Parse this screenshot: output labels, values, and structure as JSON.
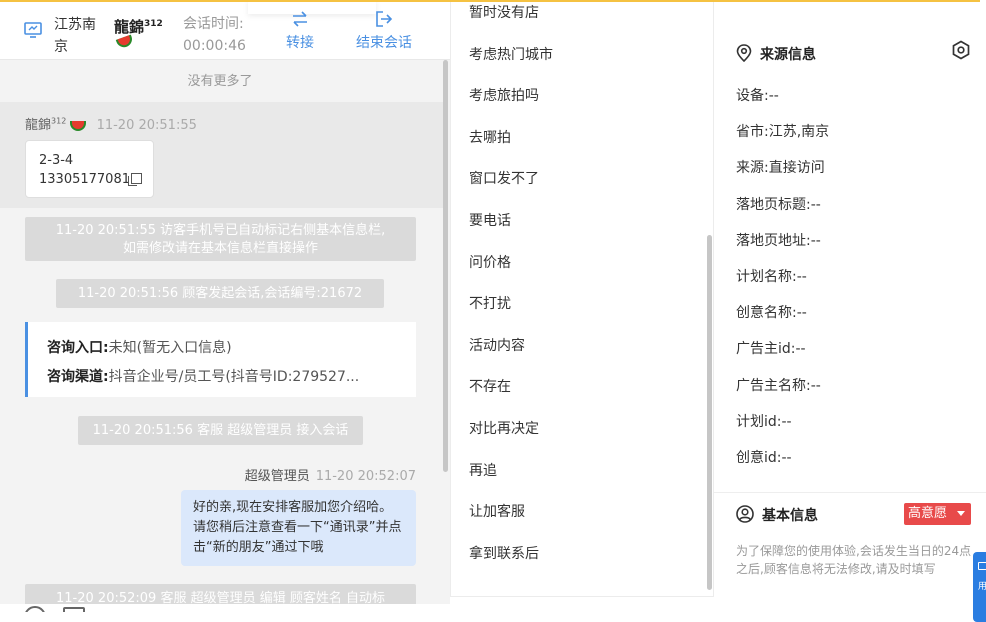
{
  "colors": {
    "accent": "#4a90e2",
    "topbar": "#f5c242",
    "badge": "#e84a4a",
    "agentBubble": "#dbe8fb"
  },
  "header": {
    "location": "江苏南京",
    "visitor_name": "龍錦",
    "visitor_sup": "312",
    "session_time_label": "会话时间:",
    "session_time_value": "00:00:46",
    "transfer_label": "转接",
    "end_session_label": "结束会话"
  },
  "chat": {
    "no_more": "没有更多了",
    "visitor_msg": {
      "name": "龍錦",
      "sup": "312",
      "time": "11-20 20:51:55",
      "line1": "2-3-4",
      "line2": "13305177081"
    },
    "sys1_line1": "11-20 20:51:55 访客手机号已自动标记右侧基本信息栏,",
    "sys1_line2": "如需修改请在基本信息栏直接操作",
    "sys2": "11-20 20:51:56 顾客发起会话,会话编号:21672",
    "consult": {
      "entry_label": "咨询入口:",
      "entry_value": "未知(暂无入口信息)",
      "channel_label": "咨询渠道:",
      "channel_value": "抖音企业号/员工号(抖音号ID:279527..."
    },
    "sys3": "11-20 20:51:56 客服 超级管理员 接入会话",
    "agent_msg": {
      "name": "超级管理员",
      "time": "11-20 20:52:07",
      "text": "好的亲,现在安排客服加您介绍哈。请您稍后注意查看一下“通讯录”并点击“新的朋友”通过下哦"
    },
    "sys4": "11-20 20:52:09 客服 超级管理员 编辑 顾客姓名 自动标"
  },
  "quick_replies": [
    "暂时没有店",
    "考虑热门城市",
    "考虑旅拍吗",
    "去哪拍",
    "窗口发不了",
    "要电话",
    "问价格",
    "不打扰",
    "活动内容",
    "不存在",
    "对比再决定",
    "再追",
    "让加客服",
    "拿到联系后"
  ],
  "source_info": {
    "title": "来源信息",
    "rows": [
      "设备:--",
      "省市:江苏,南京",
      "来源:直接访问",
      "落地页标题:--",
      "落地页地址:--",
      "计划名称:--",
      "创意名称:--",
      "广告主id:--",
      "广告主名称:--",
      "计划id:--",
      "创意id:--"
    ]
  },
  "basic_info": {
    "title": "基本信息",
    "intent_badge": "高意愿",
    "note": "为了保障您的使用体验,会话发生当日的24点之后,顾客信息将无法修改,请及时填写"
  },
  "side_tab_text": "用"
}
